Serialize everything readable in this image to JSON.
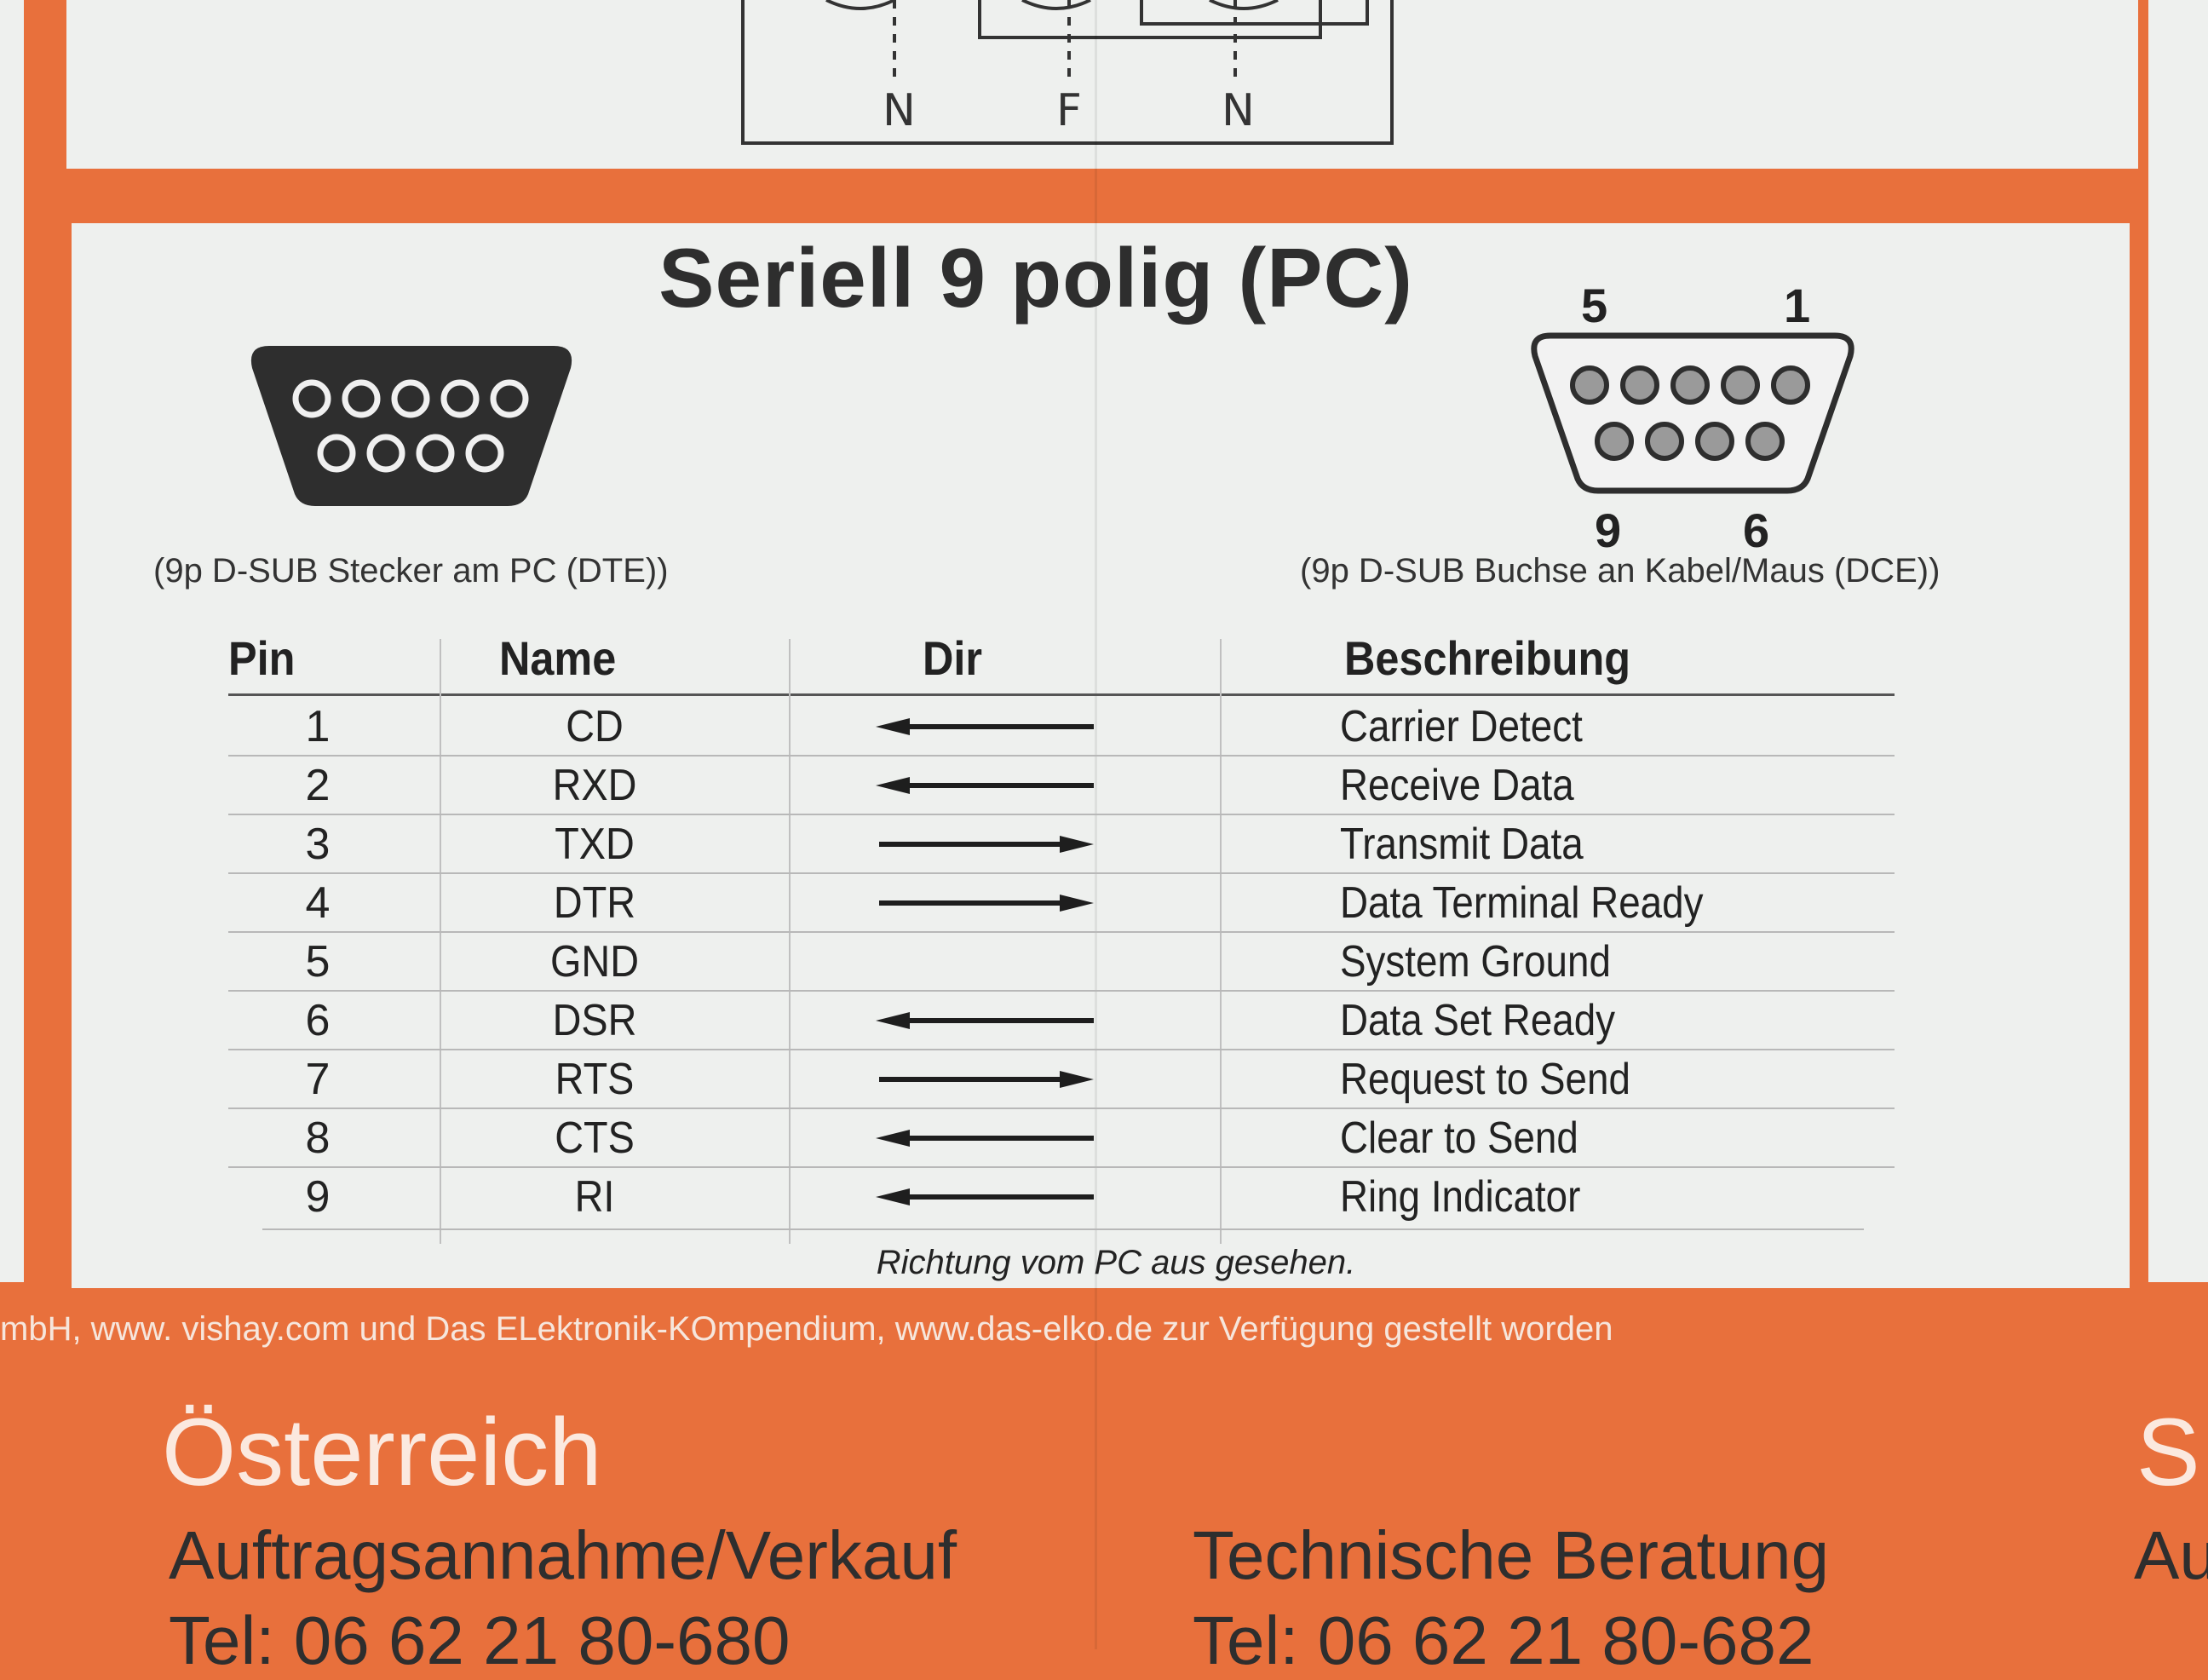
{
  "relay_diagram": {
    "labels": [
      "N",
      "F",
      "N"
    ]
  },
  "panel": {
    "title": "Seriell 9 polig (PC)",
    "male_caption": "(9p D-SUB Stecker am PC (DTE))",
    "female_caption": "(9p D-SUB Buchse an Kabel/Maus (DCE))",
    "female_pin_labels": {
      "top_left": "5",
      "top_right": "1",
      "bottom_left": "9",
      "bottom_right": "6"
    }
  },
  "table": {
    "headers": {
      "pin": "Pin",
      "name": "Name",
      "dir": "Dir",
      "description": "Beschreibung"
    },
    "rows": [
      {
        "pin": "1",
        "name": "CD",
        "dir": "in",
        "description": "Carrier Detect"
      },
      {
        "pin": "2",
        "name": "RXD",
        "dir": "in",
        "description": "Receive Data"
      },
      {
        "pin": "3",
        "name": "TXD",
        "dir": "out",
        "description": "Transmit Data"
      },
      {
        "pin": "4",
        "name": "DTR",
        "dir": "out",
        "description": "Data Terminal Ready"
      },
      {
        "pin": "5",
        "name": "GND",
        "dir": "none",
        "description": "System Ground"
      },
      {
        "pin": "6",
        "name": "DSR",
        "dir": "in",
        "description": "Data Set Ready"
      },
      {
        "pin": "7",
        "name": "RTS",
        "dir": "out",
        "description": "Request to Send"
      },
      {
        "pin": "8",
        "name": "CTS",
        "dir": "in",
        "description": "Clear to Send"
      },
      {
        "pin": "9",
        "name": "RI",
        "dir": "in",
        "description": "Ring Indicator"
      }
    ],
    "footnote": "Richtung vom PC aus gesehen."
  },
  "footer": {
    "credit": "mbH, www. vishay.com und Das ELektronik-KOmpendium, www.das-elko.de zur Verfügung gestellt worden",
    "country": "Österreich",
    "sales_label": "Auftragsannahme/Verkauf",
    "sales_tel": "Tel:  06 62 21 80-680",
    "support_label": "Technische Beratung",
    "support_tel": "Tel:  06 62 21 80-682",
    "next_country_fragment": "S",
    "next_label_fragment": "Au"
  },
  "colors": {
    "brand_orange": "#e8703c",
    "panel": "#eef0ee",
    "text": "#222222"
  }
}
